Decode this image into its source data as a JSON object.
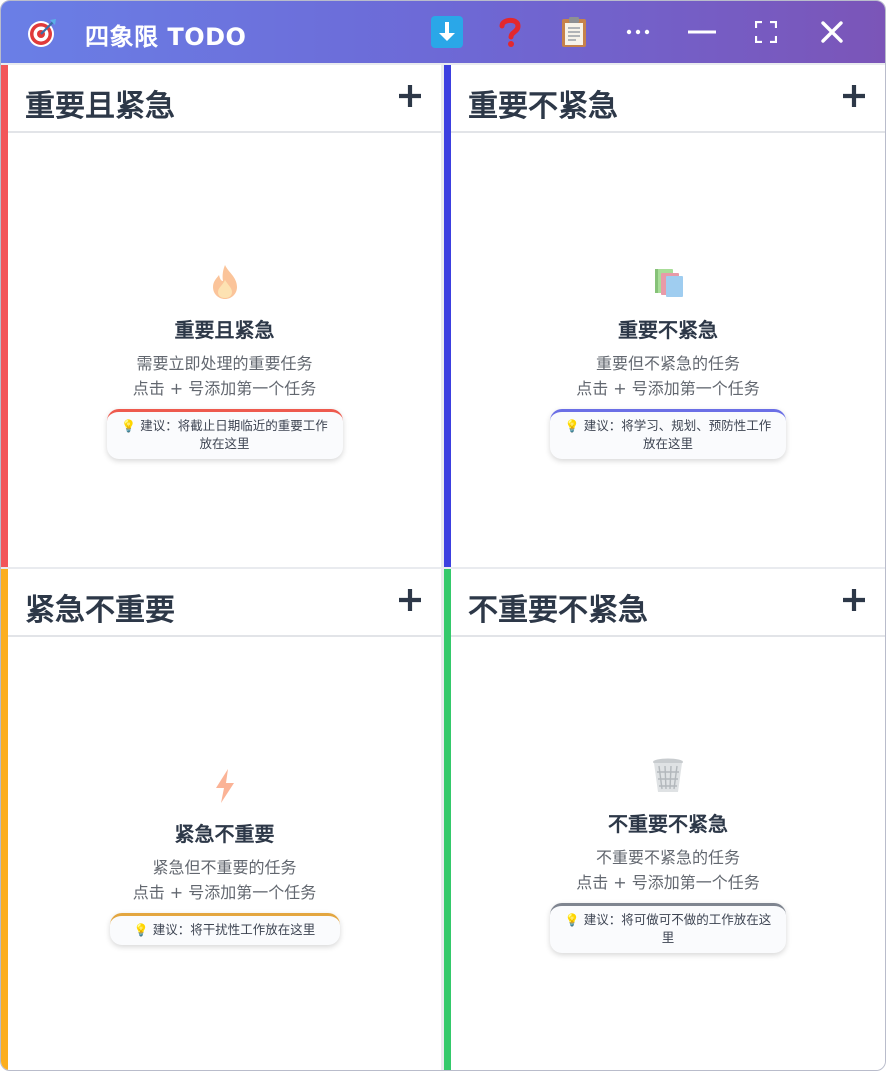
{
  "window": {
    "title": "四象限 TODO",
    "buttons": [
      "download-button",
      "help-button",
      "clipboard-button",
      "more-button",
      "minimize-button",
      "maximize-button",
      "close-button"
    ]
  },
  "colors": {
    "titlebar_start": "#6a7fe6",
    "titlebar_end": "#7b55b8",
    "q1_accent": "#f2555a",
    "q2_accent": "#3c3fe0",
    "q3_accent": "#fcae1e",
    "q4_accent": "#34c96b"
  },
  "quadrants": [
    {
      "title": "重要且紧急",
      "icon": "fire-icon",
      "empty_title": "重要且紧急",
      "desc": "需要立即处理的重要任务",
      "hint": "点击 + 号添加第一个任务",
      "tip": "建议：将截止日期临近的重要工作放在这里"
    },
    {
      "title": "重要不紧急",
      "icon": "books-icon",
      "empty_title": "重要不紧急",
      "desc": "重要但不紧急的任务",
      "hint": "点击 + 号添加第一个任务",
      "tip": "建议：将学习、规划、预防性工作放在这里"
    },
    {
      "title": "紧急不重要",
      "icon": "lightning-icon",
      "empty_title": "紧急不重要",
      "desc": "紧急但不重要的任务",
      "hint": "点击 + 号添加第一个任务",
      "tip": "建议：将干扰性工作放在这里"
    },
    {
      "title": "不重要不紧急",
      "icon": "trash-bin-icon",
      "empty_title": "不重要不紧急",
      "desc": "不重要不紧急的任务",
      "hint": "点击 + 号添加第一个任务",
      "tip": "建议：将可做可不做的工作放在这里"
    }
  ]
}
